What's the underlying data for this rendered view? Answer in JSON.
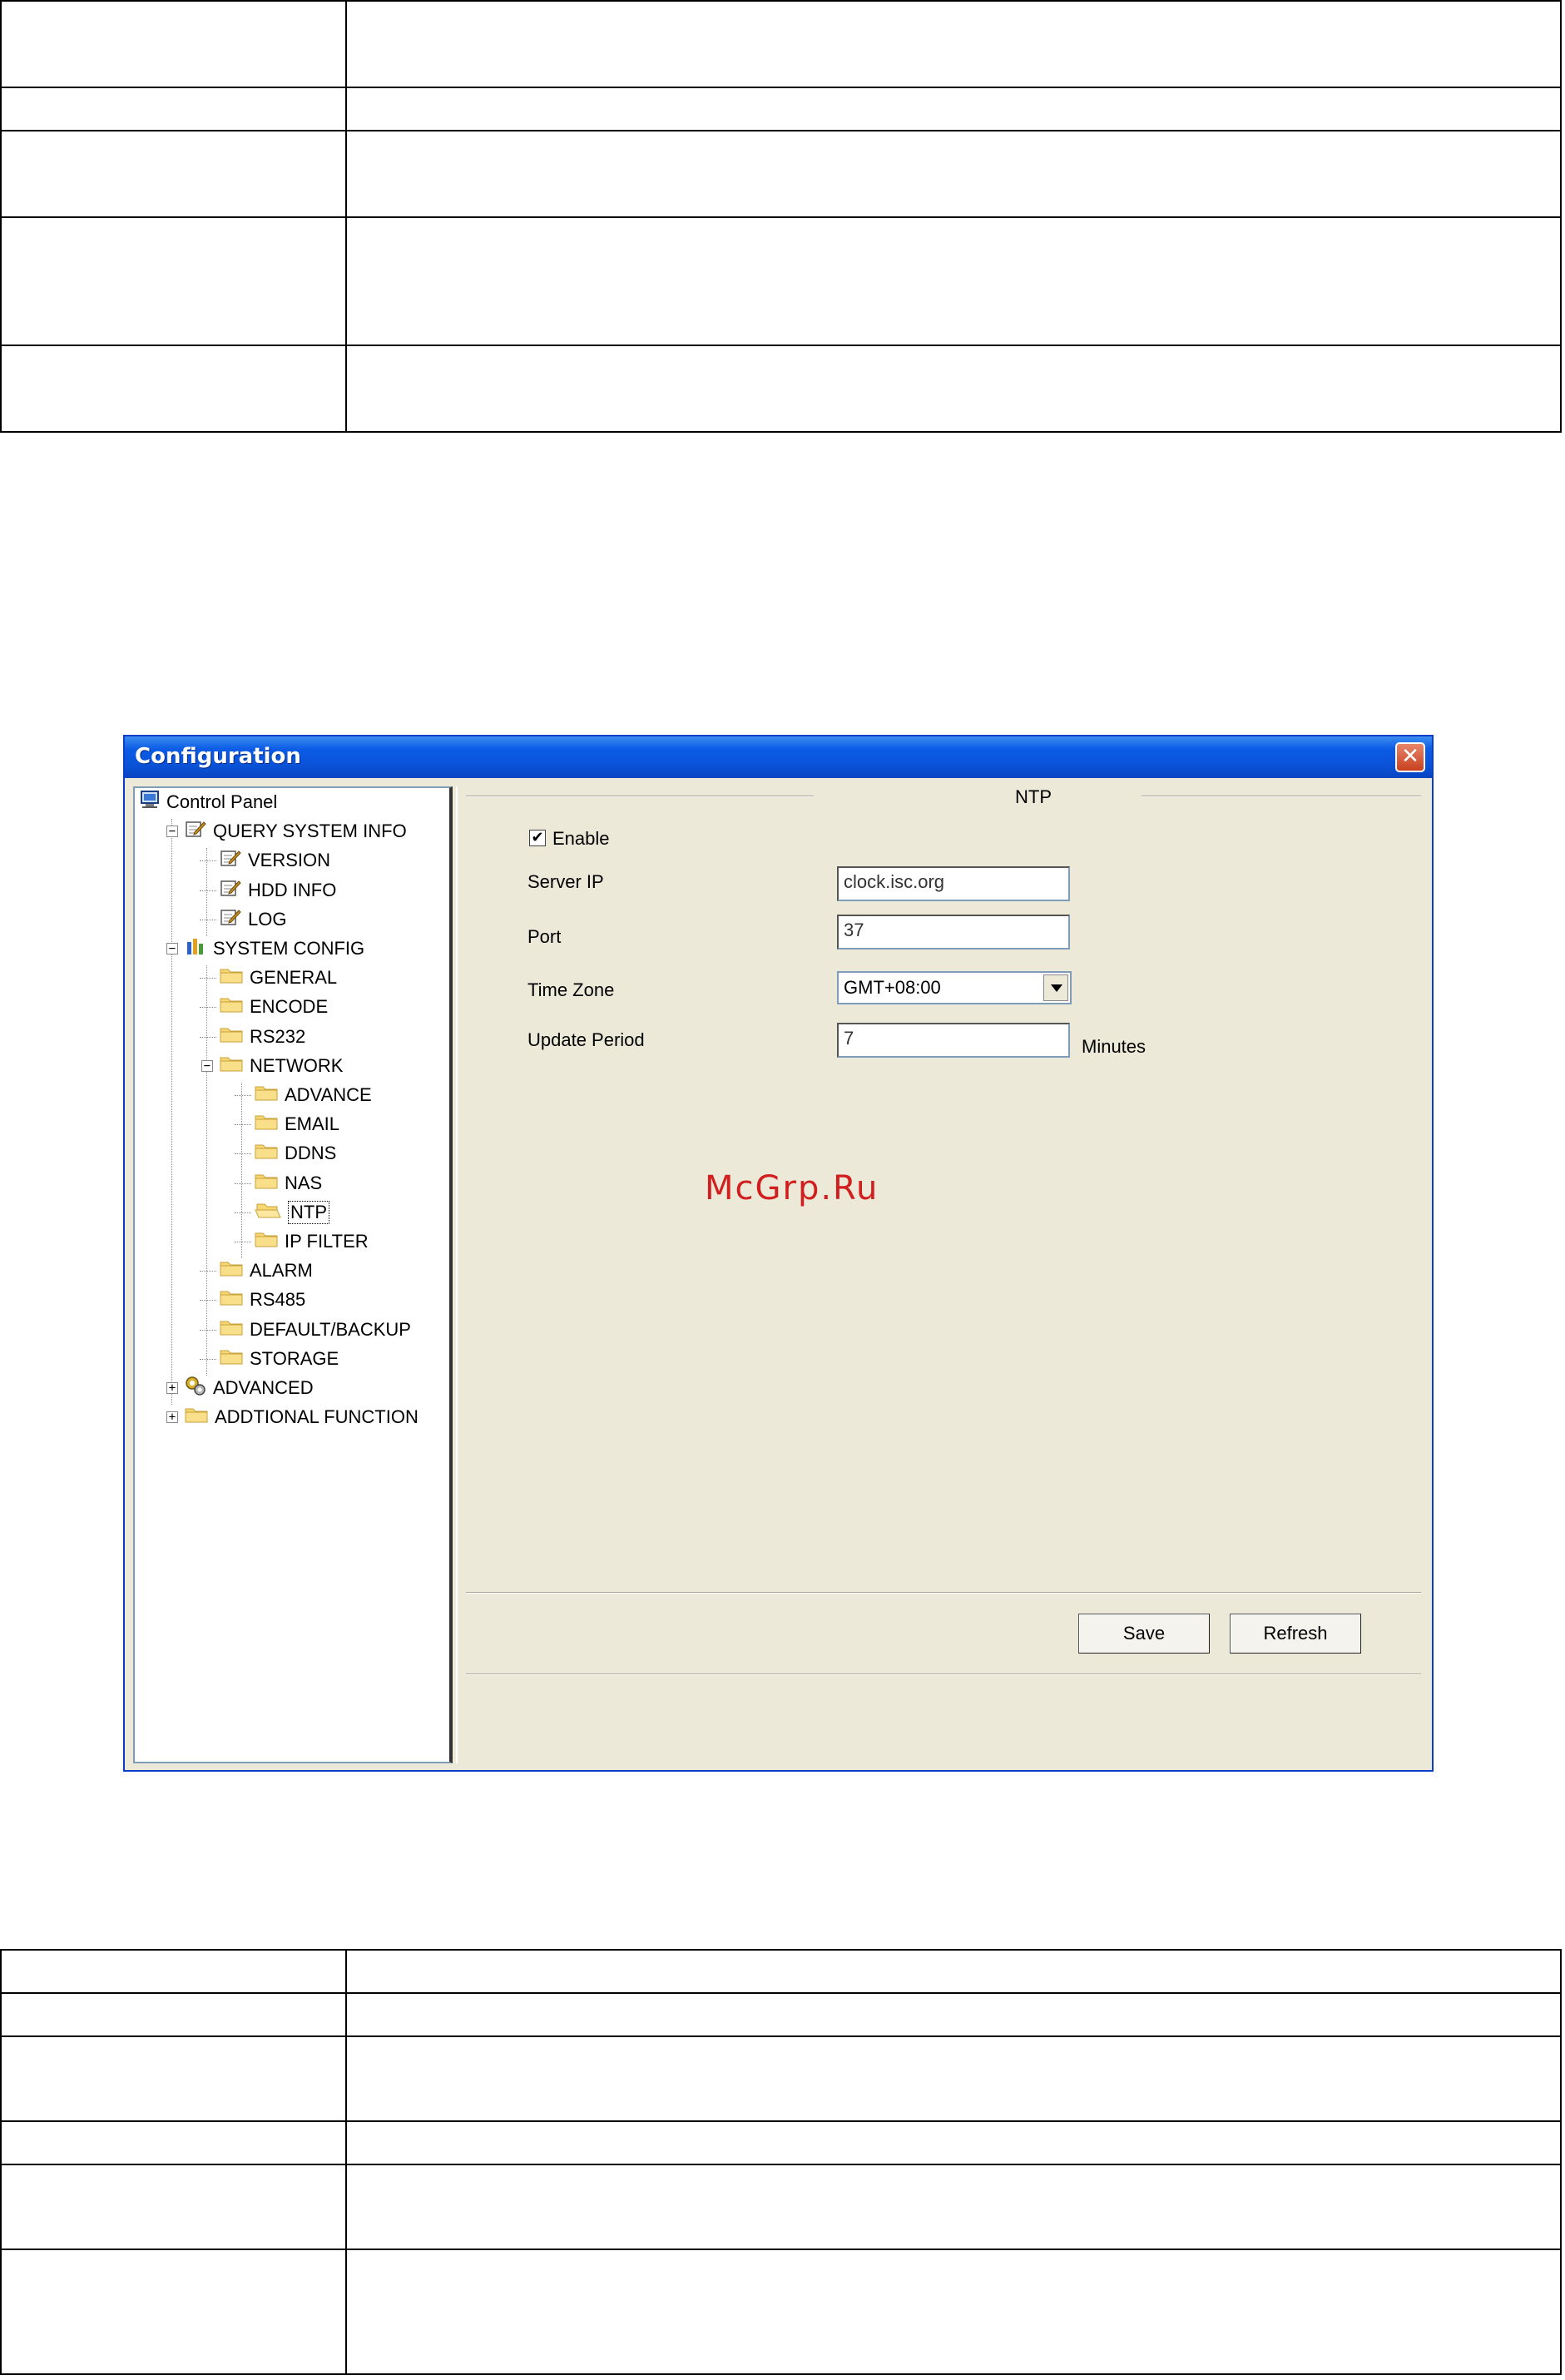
{
  "window": {
    "title": "Configuration",
    "close_glyph": "✕"
  },
  "tree": {
    "items": [
      {
        "label": "Control Panel",
        "icon": "computer-icon"
      },
      {
        "label": "QUERY SYSTEM INFO",
        "icon": "note-icon",
        "expander": "−"
      },
      {
        "label": "VERSION",
        "icon": "note-icon"
      },
      {
        "label": "HDD INFO",
        "icon": "note-icon"
      },
      {
        "label": "LOG",
        "icon": "note-icon"
      },
      {
        "label": "SYSTEM CONFIG",
        "icon": "tools-icon",
        "expander": "−"
      },
      {
        "label": "GENERAL",
        "icon": "folder-icon"
      },
      {
        "label": "ENCODE",
        "icon": "folder-icon"
      },
      {
        "label": "RS232",
        "icon": "folder-icon"
      },
      {
        "label": "NETWORK",
        "icon": "folder-icon",
        "expander": "−"
      },
      {
        "label": "ADVANCE",
        "icon": "folder-icon"
      },
      {
        "label": "EMAIL",
        "icon": "folder-icon"
      },
      {
        "label": "DDNS",
        "icon": "folder-icon"
      },
      {
        "label": "NAS",
        "icon": "folder-icon"
      },
      {
        "label": "NTP",
        "icon": "open-folder-icon",
        "selected": true
      },
      {
        "label": "IP FILTER",
        "icon": "folder-icon"
      },
      {
        "label": "ALARM",
        "icon": "folder-icon"
      },
      {
        "label": "RS485",
        "icon": "folder-icon"
      },
      {
        "label": "DEFAULT/BACKUP",
        "icon": "folder-icon"
      },
      {
        "label": "STORAGE",
        "icon": "folder-icon"
      },
      {
        "label": "ADVANCED",
        "icon": "gears-icon",
        "expander": "+"
      },
      {
        "label": "ADDTIONAL FUNCTION",
        "icon": "folder-icon",
        "expander": "+"
      }
    ]
  },
  "ntp": {
    "section_title": "NTP",
    "enable_label": "Enable",
    "enable_checked": true,
    "server_ip_label": "Server IP",
    "server_ip_value": "clock.isc.org",
    "port_label": "Port",
    "port_value": "37",
    "time_zone_label": "Time Zone",
    "time_zone_value": "GMT+08:00",
    "update_period_label": "Update Period",
    "update_period_value": "7",
    "update_period_unit": "Minutes"
  },
  "buttons": {
    "save": "Save",
    "refresh": "Refresh"
  },
  "watermark": "McGrp.Ru",
  "colors": {
    "title_bar": "#0a52d8",
    "window_bg": "#ece9d8",
    "watermark": "#d11f1f"
  }
}
